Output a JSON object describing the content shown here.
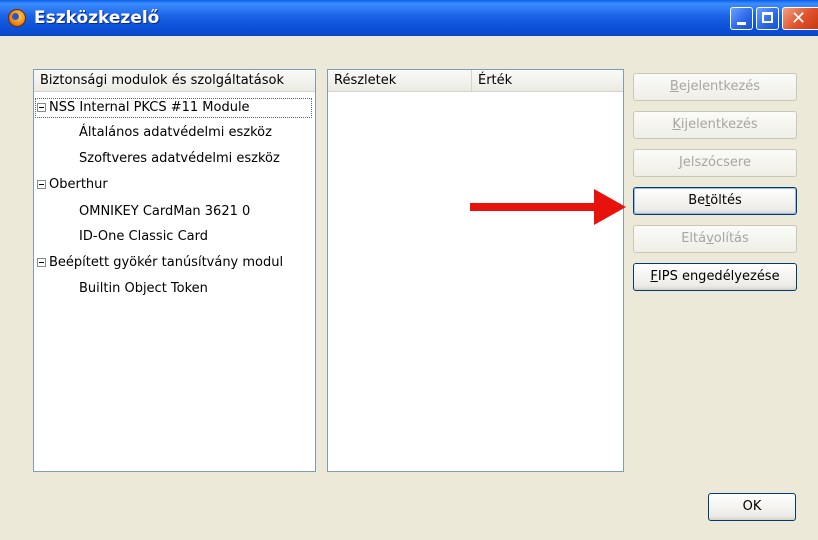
{
  "window": {
    "title": "Eszközkezelő"
  },
  "tree": {
    "header": "Biztonsági modulok és szolgáltatások",
    "nodes": [
      {
        "label": "NSS Internal PKCS #11 Module",
        "children": [
          "Általános adatvédelmi eszköz",
          "Szoftveres adatvédelmi eszköz"
        ]
      },
      {
        "label": "Oberthur",
        "children": [
          "OMNIKEY CardMan 3621 0",
          "ID-One Classic Card"
        ]
      },
      {
        "label": "Beépített gyökér tanúsítvány modul",
        "children": [
          "Builtin Object Token"
        ]
      }
    ]
  },
  "details": {
    "col1": "Részletek",
    "col2": "Érték"
  },
  "buttons": {
    "login": {
      "pre": "",
      "key": "B",
      "post": "ejelentkezés",
      "enabled": false
    },
    "logout": {
      "pre": "",
      "key": "K",
      "post": "ijelentkezés",
      "enabled": false
    },
    "change_password": {
      "pre": "",
      "key": "J",
      "post": "elszócsere",
      "enabled": false
    },
    "load": {
      "pre": "Be",
      "key": "t",
      "post": "öltés",
      "enabled": true
    },
    "unload": {
      "pre": "Eltá",
      "key": "v",
      "post": "olítás",
      "enabled": false
    },
    "fips": {
      "pre": "",
      "key": "F",
      "post": "IPS engedélyezése",
      "enabled": true
    },
    "ok": "OK"
  },
  "colors": {
    "annotation_arrow": "#e8120c",
    "titlebar": "#0a4fd6"
  },
  "icons": {
    "app": "firefox-icon",
    "minimize": "minimize-icon",
    "maximize": "maximize-icon",
    "close": "close-icon",
    "arrow": "red-arrow-annotation"
  }
}
